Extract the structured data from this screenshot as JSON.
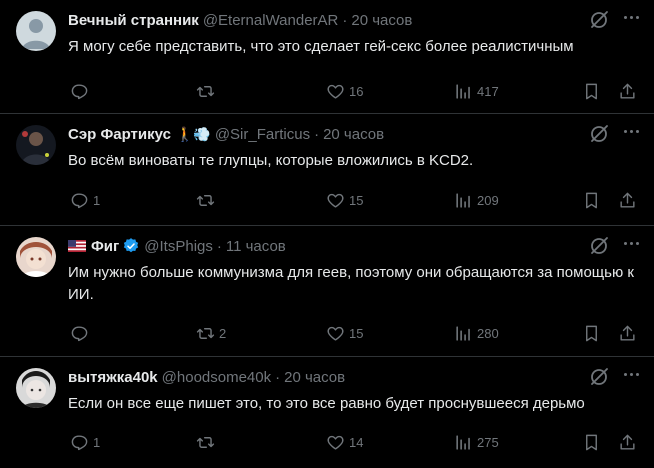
{
  "tweets": [
    {
      "name": "Вечный странник",
      "handle": "@EternalWanderAR",
      "time": "20 часов",
      "text": "Я могу себе представить, что это сделает гей-секс более реалистичным",
      "replies": "",
      "retweets": "",
      "likes": "16",
      "views": "417",
      "avatar": "default-avatar"
    },
    {
      "name": "Сэр Фартикус",
      "handle": "@Sir_Farticus",
      "time": "20 часов",
      "emoji": "🚶💨",
      "text": "Во всём виноваты те глупцы, которые вложились в KCD2.",
      "replies": "1",
      "retweets": "",
      "likes": "15",
      "views": "209",
      "avatar": "photo-avatar"
    },
    {
      "name": "Фиг",
      "handle": "@ItsPhigs",
      "time": "11 часов",
      "flag": "us-flag",
      "verified": true,
      "text": "Им нужно больше коммунизма для геев, поэтому они обращаются за помощью к ИИ.",
      "replies": "",
      "retweets": "2",
      "likes": "15",
      "views": "280",
      "avatar": "anime-avatar"
    },
    {
      "name": "вытяжка40k",
      "handle": "@hoodsome40k",
      "time": "20 часов",
      "text": "Если он все еще пишет это, то это все равно будет проснувшееся дерьмо",
      "replies": "1",
      "retweets": "",
      "likes": "14",
      "views": "275",
      "avatar": "face-avatar"
    }
  ],
  "colors": {
    "background": "#000000",
    "text": "#e7e9ea",
    "muted": "#71767b",
    "divider": "#2f3336",
    "verified": "#1d9bf0"
  }
}
